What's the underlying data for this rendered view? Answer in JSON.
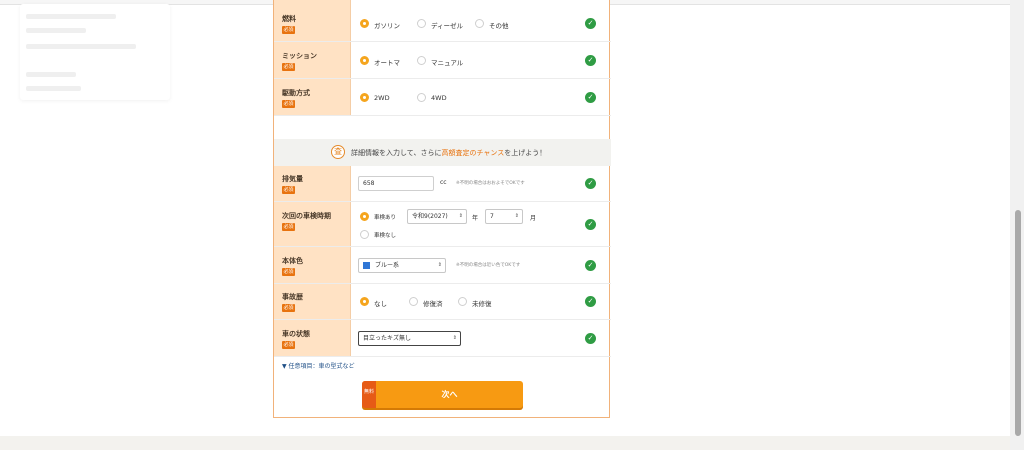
{
  "checkmark_glyph": "✓",
  "required_badge": "必須",
  "arrow_glyph": "⇕",
  "rows": {
    "fuel": {
      "label": "燃料",
      "options": [
        "ガソリン",
        "ディーゼル",
        "その他"
      ],
      "selected": "ガソリン"
    },
    "transmission": {
      "label": "ミッション",
      "options": [
        "オートマ",
        "マニュアル"
      ],
      "selected": "オートマ"
    },
    "drive": {
      "label": "駆動方式",
      "options": [
        "2WD",
        "4WD"
      ],
      "selected": "2WD"
    },
    "displacement": {
      "label": "排気量",
      "value": "658",
      "unit": "cc",
      "note": "※不明の場合はおおよそでOKです"
    },
    "inspection": {
      "label": "次回の車検時期",
      "options": [
        "車検あり",
        "車検なし"
      ],
      "selected": "車検あり",
      "era_year": "令和9(2027)",
      "year_unit": "年",
      "month": "7",
      "month_unit": "月"
    },
    "body_color": {
      "label": "本体色",
      "value": "ブルー系",
      "swatch": "#2f77d6",
      "note": "※不明の場合は近い色でOKです"
    },
    "accident": {
      "label": "事故歴",
      "options": [
        "なし",
        "修復済",
        "未修復"
      ],
      "selected": "なし"
    },
    "condition": {
      "label": "車の状態",
      "value": "目立ったキズ無し"
    }
  },
  "banner": {
    "icon": "査",
    "text_before": "詳細情報を入力して、さらに",
    "highlight": "高額査定のチャンス",
    "text_after": "を上げよう！"
  },
  "more_link": "▼ 任意項目：車の型式など",
  "next_button": {
    "badge": "無料",
    "label": "次へ"
  },
  "colors": {
    "accent": "#f79a12",
    "label_bg": "#ffe2c4",
    "required": "#e8730f",
    "check": "#2f9c44"
  }
}
